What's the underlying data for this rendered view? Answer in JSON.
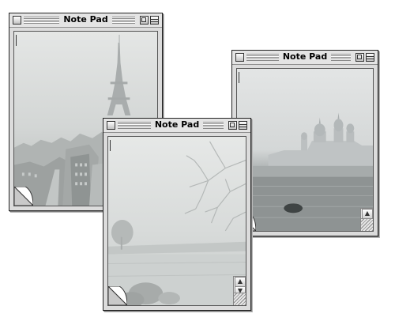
{
  "windows": [
    {
      "title": "Note Pad",
      "scene": "Eiffel Tower in fog"
    },
    {
      "title": "Note Pad",
      "scene": "Foggy field with bare tree"
    },
    {
      "title": "Note Pad",
      "scene": "Onion-domed monastery over misty water"
    }
  ],
  "icons": {
    "close": "close-box-icon",
    "zoom": "zoom-box-icon",
    "collapse": "collapse-box-icon",
    "page_curl": "page-curl-icon",
    "scroll_up": "scroll-up-arrow-icon",
    "scroll_down": "scroll-down-arrow-icon",
    "resize": "resize-grip-icon"
  },
  "colors": {
    "window_chrome": "#dcdcdc",
    "fog_light": "#e2e4e3",
    "fog_dark": "#9ea3a3"
  }
}
